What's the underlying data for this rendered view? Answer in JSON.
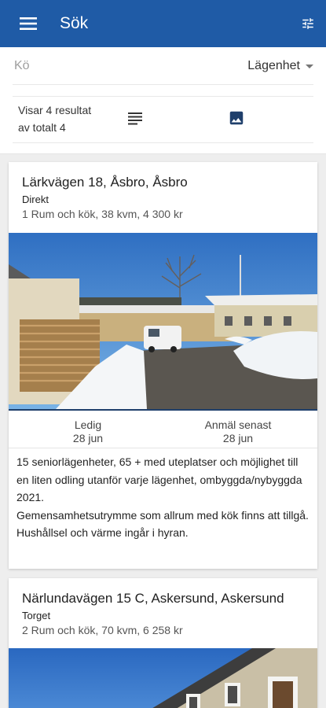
{
  "header": {
    "title": "Sök",
    "accent": "#1f5ba6"
  },
  "search": {
    "queue_placeholder": "Kö",
    "type_selected": "Lägenhet"
  },
  "results": {
    "count_line1": "Visar 4 resultat",
    "count_line2": "av totalt 4"
  },
  "listings": [
    {
      "address": "Lärkvägen 18, Åsbro, Åsbro",
      "area": "Direkt",
      "info": "1 Rum och kök, 38 kvm, 4 300 kr",
      "available_label": "Ledig",
      "available_date": "28 jun",
      "deadline_label": "Anmäl senast",
      "deadline_date": "28 jun",
      "description": [
        "15 seniorlägenheter, 65 + med uteplatser och möjlighet till en liten odling utanför varje lägenhet, ombyggda/nybyggda 2021.",
        "Gemensamhetsutrymme som allrum med kök finns att tillgå.",
        "Hushållsel och värme ingår i hyran."
      ]
    },
    {
      "address": "Närlundavägen 15 C, Askersund, Askersund",
      "area": "Torget",
      "info": "2 Rum och kök, 70 kvm, 6 258 kr"
    }
  ]
}
